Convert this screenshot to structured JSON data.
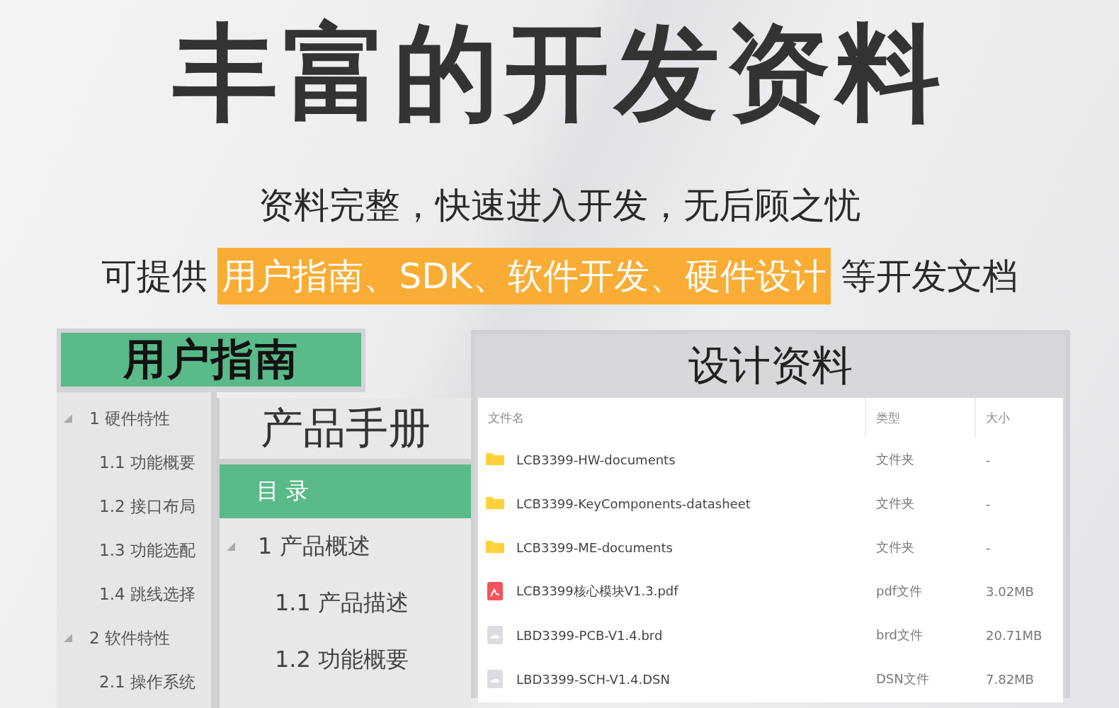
{
  "headline": "丰富的开发资料",
  "tagline": "资料完整，快速进入开发，无后顾之忧",
  "offer": {
    "lead": "可提供",
    "highlight": "用户指南、SDK、软件开发、硬件设计",
    "tail": "等开发文档"
  },
  "user_guide": {
    "title": "用户指南",
    "tree": [
      {
        "label": "1 硬件特性",
        "expanded": true,
        "children": [
          {
            "label": "1.1 功能概要"
          },
          {
            "label": "1.2 接口布局"
          },
          {
            "label": "1.3 功能选配"
          },
          {
            "label": "1.4 跳线选择"
          }
        ]
      },
      {
        "label": "2 软件特性",
        "expanded": true,
        "children": [
          {
            "label": "2.1 操作系统"
          }
        ]
      }
    ],
    "manual": {
      "title": "产品手册",
      "toc": "目 录",
      "tree": [
        {
          "label": "1 产品概述",
          "expanded": true,
          "children": [
            {
              "label": "1.1 产品描述"
            },
            {
              "label": "1.2 功能概要"
            }
          ]
        }
      ]
    }
  },
  "design_files": {
    "title": "设计资料",
    "columns": [
      "文件名",
      "类型",
      "大小"
    ],
    "rows": [
      {
        "kind": "folder",
        "name": "LCB3399-HW-documents",
        "type": "文件夹",
        "size": "-"
      },
      {
        "kind": "folder",
        "name": "LCB3399-KeyComponents-datasheet",
        "type": "文件夹",
        "size": "-"
      },
      {
        "kind": "folder",
        "name": "LCB3399-ME-documents",
        "type": "文件夹",
        "size": "-"
      },
      {
        "kind": "pdf",
        "name": "LCB3399核心模块V1.3.pdf",
        "type": "pdf文件",
        "size": "3.02MB"
      },
      {
        "kind": "file",
        "name": "LBD3399-PCB-V1.4.brd",
        "type": "brd文件",
        "size": "20.71MB"
      },
      {
        "kind": "file",
        "name": "LBD3399-SCH-V1.4.DSN",
        "type": "DSN文件",
        "size": "7.82MB"
      }
    ]
  }
}
